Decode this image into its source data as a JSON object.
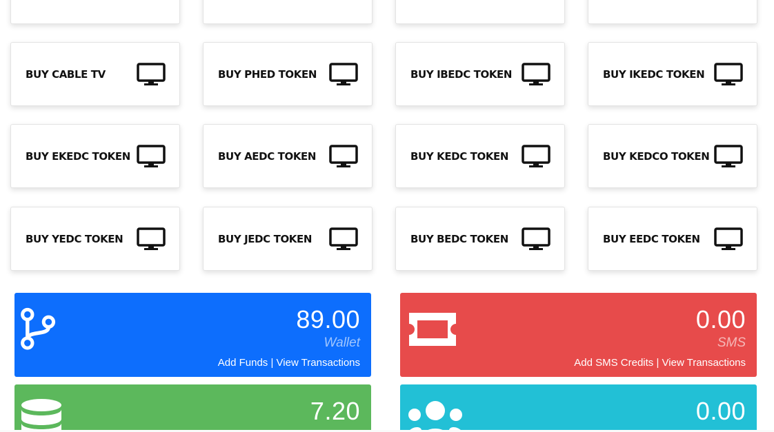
{
  "tiles": [
    {
      "label": "BUY CABLE TV"
    },
    {
      "label": "BUY PHED TOKEN"
    },
    {
      "label": "BUY IBEDC TOKEN"
    },
    {
      "label": "BUY IKEDC TOKEN"
    },
    {
      "label": "BUY EKEDC TOKEN"
    },
    {
      "label": "BUY AEDC TOKEN"
    },
    {
      "label": "BUY KEDC TOKEN"
    },
    {
      "label": "BUY KEDCO TOKEN"
    },
    {
      "label": "BUY YEDC TOKEN"
    },
    {
      "label": "BUY JEDC TOKEN"
    },
    {
      "label": "BUY BEDC TOKEN"
    },
    {
      "label": "BUY EEDC TOKEN"
    }
  ],
  "wallet_card": {
    "value": "89.00",
    "label": "Wallet",
    "link_add": "Add Funds",
    "separator": " | ",
    "link_view": "View Transactions",
    "color": "#0d6efd",
    "icon": "code-branch-icon"
  },
  "sms_card": {
    "value": "0.00",
    "label": "SMS",
    "link_add": "Add SMS Credits",
    "separator": " | ",
    "link_view": "View Transactions",
    "color": "#e74b4b",
    "icon": "ticket-icon"
  },
  "cashback_card": {
    "value": "7.20",
    "color": "#5cb85c",
    "icon": "database-icon"
  },
  "users_card": {
    "value": "0.00",
    "color": "#22c0d6",
    "icon": "users-icon"
  },
  "colors": {
    "tile_text": "#111111",
    "tile_border": "#e3e3e3"
  }
}
